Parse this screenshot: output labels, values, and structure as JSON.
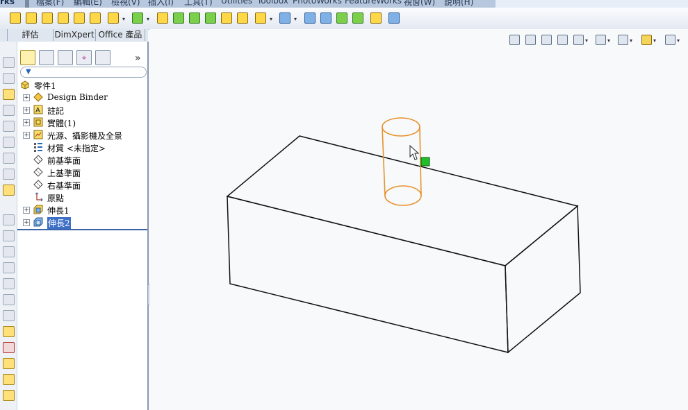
{
  "menubar": {
    "brand": "rks",
    "items": [
      "檔案(F)",
      "編輯(E)",
      "檢視(V)",
      "插入(I)",
      "工具(T)",
      "Utilities",
      "Toolbox",
      "PhotoWorks",
      "FeatureWorks",
      "視窗(W)",
      "說明(H)"
    ]
  },
  "tabs": [
    "評估",
    "DimXpert",
    "Office 產品"
  ],
  "feature_tree": {
    "root": "零件1",
    "items": [
      {
        "label": "Design Binder",
        "icon": "design-binder-icon",
        "expandable": true
      },
      {
        "label": "註記",
        "icon": "annotations-icon",
        "expandable": true
      },
      {
        "label": "實體(1)",
        "icon": "solid-bodies-icon",
        "expandable": true
      },
      {
        "label": "光源、攝影機及全景",
        "icon": "lights-cameras-icon",
        "expandable": true
      },
      {
        "label": "材質 <未指定>",
        "icon": "material-icon",
        "expandable": false
      },
      {
        "label": "前基準面",
        "icon": "plane-icon",
        "expandable": false
      },
      {
        "label": "上基準面",
        "icon": "plane-icon",
        "expandable": false
      },
      {
        "label": "右基準面",
        "icon": "plane-icon",
        "expandable": false
      },
      {
        "label": "原點",
        "icon": "origin-icon",
        "expandable": false
      },
      {
        "label": "伸長1",
        "icon": "extrude-icon",
        "expandable": true
      },
      {
        "label": "伸長2",
        "icon": "extrude-icon",
        "expandable": true,
        "selected": true
      }
    ]
  },
  "panel_tabs": [
    "featuremanager-icon",
    "propertymanager-icon",
    "configurationmanager-icon",
    "dimxpert-icon",
    "display-manager-icon"
  ],
  "view_tools": [
    "zoom-to-fit-icon",
    "zoom-to-area-icon",
    "previous-view-icon",
    "section-view-icon",
    "view-orientation-icon",
    "display-style-icon",
    "hide-show-items-icon",
    "edit-appearance-icon",
    "apply-scene-icon",
    "view-settings-icon"
  ],
  "colors": {
    "selection": "#e8902a",
    "handle": "#1fbf2a",
    "tree_selected": "#3d6fc6"
  }
}
